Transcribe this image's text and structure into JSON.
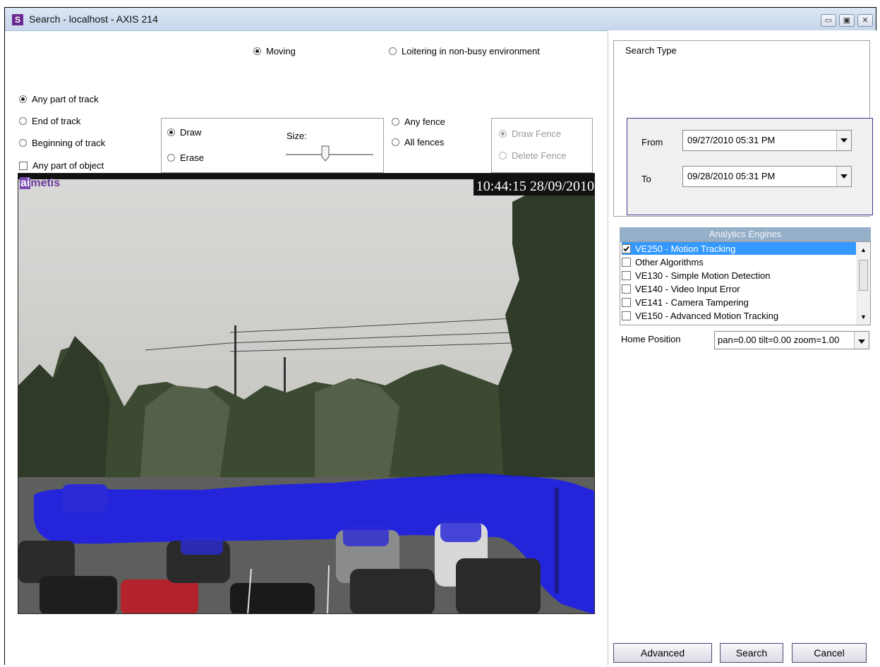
{
  "window": {
    "app_icon": "S",
    "title": "Search - localhost - AXIS 214",
    "controls": [
      "minimize",
      "maximize",
      "close"
    ]
  },
  "mode": {
    "moving_label": "Moving",
    "loitering_label": "Loitering in non-busy environment",
    "selected": "Moving"
  },
  "track": {
    "any_part_label": "Any part of track",
    "end_label": "End of track",
    "beginning_label": "Beginning of track",
    "any_part_object_label": "Any part of object",
    "selected": "Any part of track"
  },
  "draw_group": {
    "draw_label": "Draw",
    "erase_label": "Erase",
    "size_label": "Size:",
    "selected": "Draw",
    "size_level": 0.45
  },
  "fence": {
    "any_label": "Any fence",
    "all_label": "All fences",
    "draw_fence_label": "Draw Fence",
    "delete_fence_label": "Delete Fence"
  },
  "video": {
    "timestamp": "10:44:15 28/09/2010",
    "logo_first": "ai",
    "logo_rest": "metis"
  },
  "search_type": {
    "legend": "Search Type",
    "from_label": "From",
    "from_value": "09/27/2010 05:31 PM",
    "to_label": "To",
    "to_value": "09/28/2010 05:31 PM"
  },
  "engines": {
    "header": "Analytics Engines",
    "items": [
      {
        "label": "VE250 - Motion Tracking",
        "checked": true,
        "selected": true
      },
      {
        "label": "Other Algorithms",
        "checked": false
      },
      {
        "label": "VE130 - Simple Motion Detection",
        "checked": false
      },
      {
        "label": "VE140 - Video Input Error",
        "checked": false
      },
      {
        "label": "VE141 - Camera Tampering",
        "checked": false
      },
      {
        "label": "VE150 - Advanced Motion Tracking",
        "checked": false
      }
    ]
  },
  "home_position": {
    "label": "Home Position",
    "value": "pan=0.00 tilt=0.00 zoom=1.00"
  },
  "buttons": {
    "advanced": "Advanced",
    "search": "Search",
    "cancel": "Cancel"
  },
  "colors": {
    "overlay_blue": "#1414ff",
    "selection": "#3399ff",
    "engines_header": "#95afc9"
  }
}
